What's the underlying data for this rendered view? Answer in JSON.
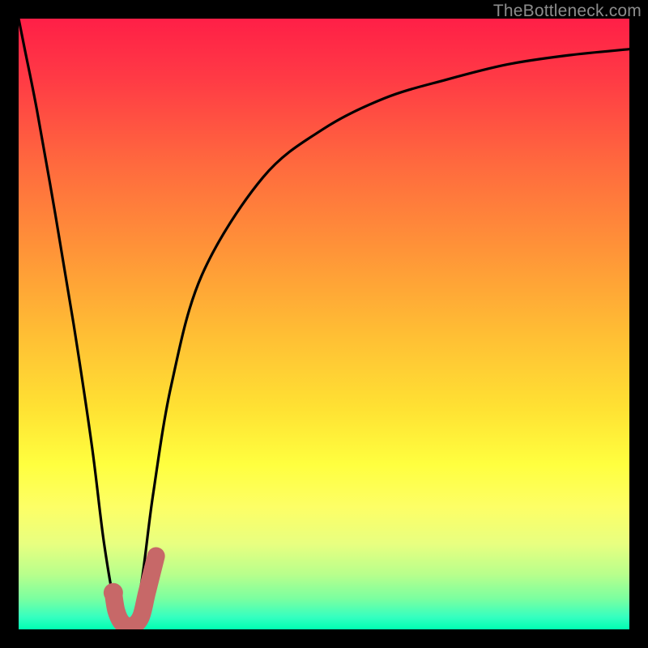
{
  "watermark": "TheBottleneck.com",
  "colors": {
    "background": "#000000",
    "gradient_top": "#ff1f47",
    "gradient_bottom": "#00ffb2",
    "curve_stroke": "#000000",
    "marker_stroke": "#c76868"
  },
  "chart_data": {
    "type": "line",
    "title": "",
    "xlabel": "",
    "ylabel": "",
    "xlim": [
      0,
      100
    ],
    "ylim": [
      0,
      100
    ],
    "annotations": [],
    "series": [
      {
        "name": "bottleneck-curve",
        "x": [
          0,
          1,
          3,
          6,
          9,
          12,
          14,
          16,
          18,
          20,
          22,
          25,
          30,
          40,
          50,
          60,
          70,
          80,
          90,
          100
        ],
        "values": [
          100,
          95,
          85,
          68,
          50,
          30,
          14,
          3,
          0,
          7,
          22,
          40,
          58,
          74,
          82,
          87,
          90,
          92.5,
          94,
          95
        ]
      }
    ],
    "marker": {
      "name": "j-marker",
      "path_x": [
        15.5,
        16,
        17,
        18.5,
        20,
        21,
        22.5
      ],
      "path_values": [
        6,
        3,
        1,
        0.5,
        2,
        6,
        12
      ],
      "dot": {
        "x": 15.5,
        "y": 6
      }
    }
  }
}
